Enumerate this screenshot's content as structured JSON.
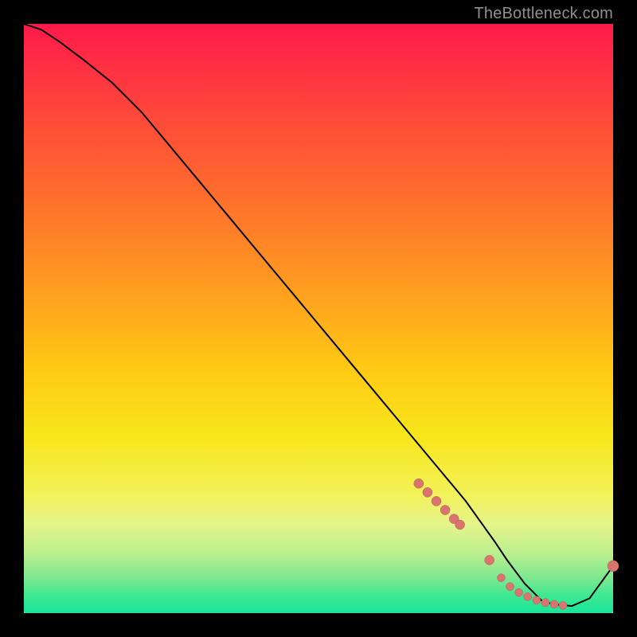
{
  "watermark": "TheBottleneck.com",
  "chart_data": {
    "type": "line",
    "title": "",
    "xlabel": "",
    "ylabel": "",
    "xlim": [
      0,
      100
    ],
    "ylim": [
      0,
      100
    ],
    "grid": false,
    "legend": false,
    "series": [
      {
        "name": "curve",
        "x": [
          0,
          3,
          6,
          10,
          15,
          20,
          25,
          30,
          35,
          40,
          45,
          50,
          55,
          60,
          65,
          70,
          75,
          80,
          82,
          85,
          88,
          90,
          93,
          96,
          100
        ],
        "y": [
          100,
          99,
          97,
          94,
          90,
          85,
          79,
          73,
          67,
          61,
          55,
          49,
          43,
          37,
          31,
          25,
          19,
          12,
          9,
          5,
          2,
          1.5,
          1.2,
          2.5,
          8
        ]
      }
    ],
    "scatter": [
      {
        "name": "highlight-dots",
        "x": [
          67,
          68.5,
          70,
          71.5,
          73,
          74,
          79,
          81,
          82.5,
          84,
          85.5,
          87,
          88.5,
          90,
          91.5,
          100
        ],
        "y": [
          22,
          20.5,
          19,
          17.5,
          16,
          15,
          9,
          6,
          4.5,
          3.5,
          2.8,
          2.2,
          1.8,
          1.5,
          1.3,
          8
        ],
        "r": [
          6,
          6,
          6,
          6,
          6,
          6,
          6,
          5,
          5,
          5,
          5,
          5,
          5,
          5,
          5,
          7
        ]
      }
    ],
    "background_gradient": {
      "type": "vertical",
      "stops": [
        {
          "pos": 0.0,
          "color": "#ff1a4a"
        },
        {
          "pos": 0.5,
          "color": "#ffb81a"
        },
        {
          "pos": 0.8,
          "color": "#f2f25a"
        },
        {
          "pos": 1.0,
          "color": "#17e69a"
        }
      ]
    }
  }
}
